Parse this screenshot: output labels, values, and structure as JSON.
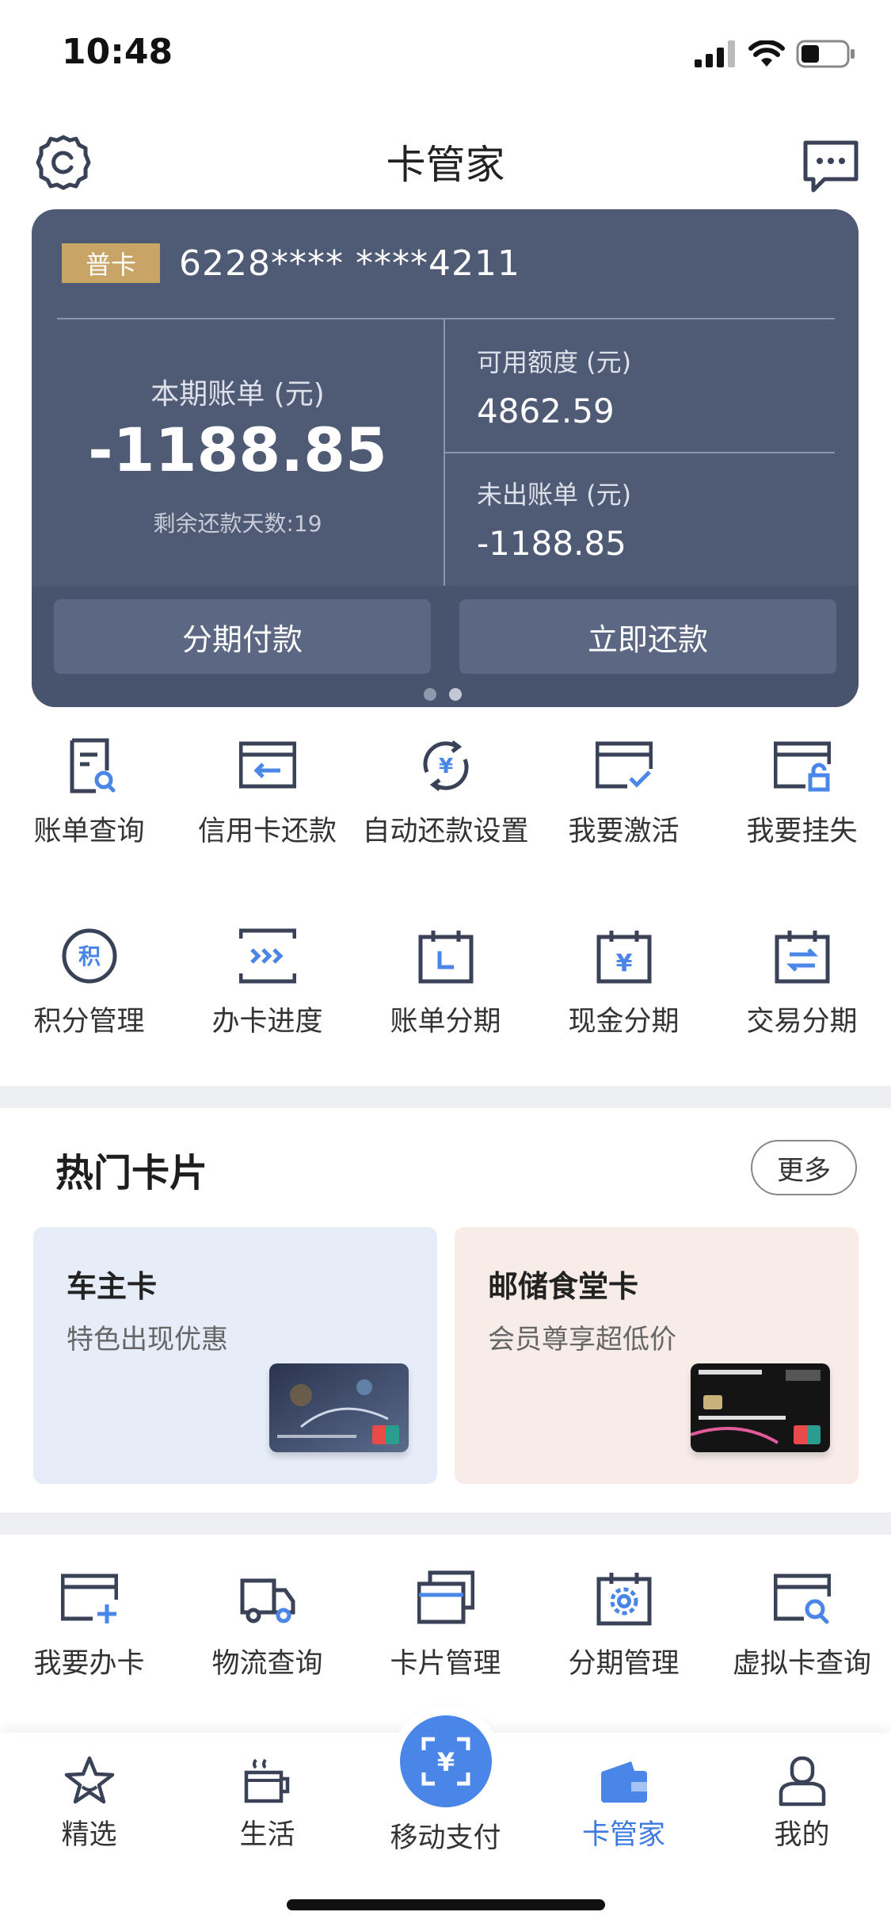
{
  "status_bar": {
    "time": "10:48"
  },
  "header": {
    "title": "卡管家"
  },
  "card": {
    "badge": "普卡",
    "number": "6228**** ****4211",
    "current_bill_label": "本期账单 (元)",
    "current_bill_value": "-1188.85",
    "days_remaining": "剩余还款天数:19",
    "available_label": "可用额度 (元)",
    "available_value": "4862.59",
    "unbilled_label": "未出账单 (元)",
    "unbilled_value": "-1188.85",
    "btn_installment": "分期付款",
    "btn_repay": "立即还款"
  },
  "grid_row1": [
    {
      "label": "账单查询",
      "icon": "bill-search-icon"
    },
    {
      "label": "信用卡还款",
      "icon": "card-repay-icon"
    },
    {
      "label": "自动还款设置",
      "icon": "auto-repay-icon"
    },
    {
      "label": "我要激活",
      "icon": "activate-card-icon"
    },
    {
      "label": "我要挂失",
      "icon": "report-loss-icon"
    }
  ],
  "grid_row2": [
    {
      "label": "积分管理",
      "icon": "points-icon",
      "glyph": "积"
    },
    {
      "label": "办卡进度",
      "icon": "progress-icon"
    },
    {
      "label": "账单分期",
      "icon": "bill-installment-icon"
    },
    {
      "label": "现金分期",
      "icon": "cash-installment-icon"
    },
    {
      "label": "交易分期",
      "icon": "transaction-installment-icon"
    }
  ],
  "hot_cards": {
    "title": "热门卡片",
    "more": "更多",
    "items": [
      {
        "title": "车主卡",
        "subtitle": "特色出现优惠"
      },
      {
        "title": "邮储食堂卡",
        "subtitle": "会员尊享超低价"
      }
    ]
  },
  "grid_row3": [
    {
      "label": "我要办卡",
      "icon": "apply-card-icon"
    },
    {
      "label": "物流查询",
      "icon": "logistics-icon"
    },
    {
      "label": "卡片管理",
      "icon": "card-manage-icon"
    },
    {
      "label": "分期管理",
      "icon": "installment-manage-icon"
    },
    {
      "label": "虚拟卡查询",
      "icon": "virtual-card-search-icon"
    }
  ],
  "bottom_nav": [
    {
      "label": "精选",
      "icon": "star-icon"
    },
    {
      "label": "生活",
      "icon": "cup-icon"
    },
    {
      "label": "移动支付",
      "icon": "scan-pay-icon"
    },
    {
      "label": "卡管家",
      "icon": "wallet-icon",
      "active": true
    },
    {
      "label": "我的",
      "icon": "user-icon"
    }
  ],
  "colors": {
    "accent": "#4a86e8",
    "card_panel": "#4f5a75",
    "badge": "#c8a467",
    "icon_stroke": "#3a4257"
  }
}
